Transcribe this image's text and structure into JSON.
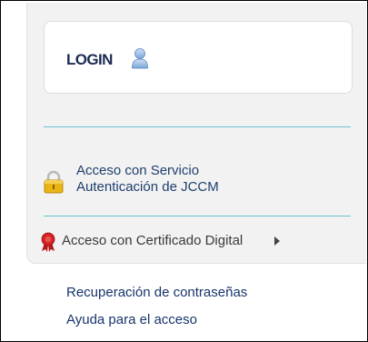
{
  "login": {
    "label": "LOGIN",
    "icon": "user-icon"
  },
  "jccm_access": {
    "line1": "Acceso con Servicio",
    "line2": "Autenticación de JCCM",
    "icon": "lock-icon"
  },
  "cert_access": {
    "label": "Acceso con Certificado Digital",
    "icon": "ribbon-icon",
    "arrow_icon": "caret-right-icon"
  },
  "links": {
    "password_recovery": "Recuperación de contraseñas",
    "access_help": "Ayuda para el acceso"
  },
  "colors": {
    "panel_bg": "#f2f2f2",
    "separator": "#6bc1d6",
    "link": "#17356b",
    "login_text": "#1b2a52",
    "ribbon": "#d32020",
    "lock": "#e9b416"
  }
}
